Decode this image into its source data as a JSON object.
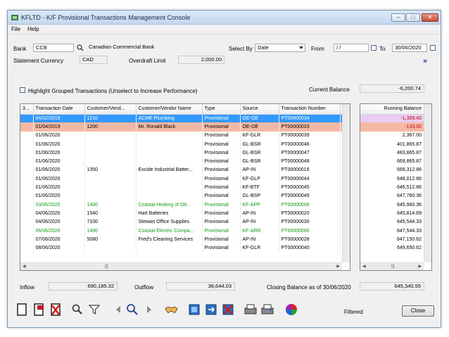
{
  "window": {
    "title": "KFLTD - K/F Provisional Transactions Management Console"
  },
  "menu": [
    "File",
    "Help"
  ],
  "bank": {
    "label": "Bank",
    "code": "CCB",
    "name": "Canadian Commercial Bank"
  },
  "select_by": {
    "label": "Select By",
    "value": "Date"
  },
  "from": {
    "label": "From",
    "value": "/ /"
  },
  "to": {
    "label": "To",
    "value": "30/06/2020"
  },
  "statement_currency": {
    "label": "Statement Currency",
    "value": "CAD"
  },
  "overdraft": {
    "label": "Overdraft Limit",
    "value": "2,000.00"
  },
  "highlight": {
    "label": "Highlight Grouped Transactions (Unselect to Increase Performance)"
  },
  "current_balance": {
    "label": "Current Balance",
    "value": "-6,200.74"
  },
  "grid": {
    "columns": [
      "3...",
      "Transaction Date",
      "Customer/Vend...",
      "Customer/Vendor Name",
      "Type",
      "Source",
      "Transaction Number",
      "D"
    ],
    "rows": [
      {
        "date": "04/02/2019",
        "code": "1210",
        "name": "ACME Plumbing",
        "type": "Provisional",
        "source": "OE-OE",
        "num": "PT00000034",
        "d": "",
        "style": "sel"
      },
      {
        "date": "01/04/2019",
        "code": "1200",
        "name": "Mr. Ronald Black",
        "type": "Provisional",
        "source": "OE-OE",
        "num": "PT00000033",
        "d": "",
        "style": "salmon"
      },
      {
        "date": "01/06/2020",
        "code": "",
        "name": "",
        "type": "Provisional",
        "source": "KF-GLR",
        "num": "PT00000039",
        "d": "E",
        "style": ""
      },
      {
        "date": "01/06/2020",
        "code": "",
        "name": "",
        "type": "Provisional",
        "source": "GL-BSR",
        "num": "PT00000046",
        "d": "A",
        "style": ""
      },
      {
        "date": "01/06/2020",
        "code": "",
        "name": "",
        "type": "Provisional",
        "source": "GL-BSR",
        "num": "PT00000047",
        "d": "A",
        "style": ""
      },
      {
        "date": "01/06/2020",
        "code": "",
        "name": "",
        "type": "Provisional",
        "source": "GL-BSR",
        "num": "PT00000048",
        "d": "A",
        "style": ""
      },
      {
        "date": "01/06/2020",
        "code": "1350",
        "name": "Excide Industrial Batter...",
        "type": "Provisional",
        "source": "AP-IN",
        "num": "PT00000016",
        "d": ".",
        "style": ""
      },
      {
        "date": "01/06/2020",
        "code": "",
        "name": "",
        "type": "Provisional",
        "source": "KF-GLP",
        "num": "PT00000044",
        "d": "L",
        "style": ""
      },
      {
        "date": "01/06/2020",
        "code": "",
        "name": "",
        "type": "Provisional",
        "source": "KF-BTF",
        "num": "PT00000045",
        "d": "",
        "style": ""
      },
      {
        "date": "01/06/2020",
        "code": "",
        "name": "",
        "type": "Provisional",
        "source": "GL-BSP",
        "num": "PT00000049",
        "d": "A",
        "style": ""
      },
      {
        "date": "03/06/2020",
        "code": "1400",
        "name": "Coastal Heating of Ott...",
        "type": "Provisional",
        "source": "KF-APP",
        "num": "PT00000008",
        "d": "(",
        "style": "green"
      },
      {
        "date": "04/06/2020",
        "code": "1540",
        "name": "Hart Batteries",
        "type": "Provisional",
        "source": "AP-IN",
        "num": "PT00000020",
        "d": ".",
        "style": ""
      },
      {
        "date": "04/06/2020",
        "code": "7100",
        "name": "Stewart Office Supplies",
        "type": "Provisional",
        "source": "AP-IN",
        "num": "PT00000030",
        "d": ".",
        "style": ""
      },
      {
        "date": "06/06/2020",
        "code": "1400",
        "name": "Coastal Electric Compa...",
        "type": "Provisional",
        "source": "KF-ARR",
        "num": "PT00000006",
        "d": "(",
        "style": "green"
      },
      {
        "date": "07/06/2020",
        "code": "5080",
        "name": "Fred's Cleaning Services",
        "type": "Provisional",
        "source": "AP-IN",
        "num": "PT00000028",
        "d": ".",
        "style": ""
      },
      {
        "date": "08/06/2020",
        "code": "",
        "name": "",
        "type": "Provisional",
        "source": "KF-GLR",
        "num": "PT00000040",
        "d": "E",
        "style": ""
      }
    ]
  },
  "running_balance": {
    "header": "Running Balance",
    "values": [
      {
        "v": "-1,359.40",
        "style": "pink"
      },
      {
        "v": "-133.00",
        "style": "salmon2"
      },
      {
        "v": "2,367.00",
        "style": ""
      },
      {
        "v": "401,865.87",
        "style": ""
      },
      {
        "v": "483,865.87",
        "style": ""
      },
      {
        "v": "669,865.87",
        "style": ""
      },
      {
        "v": "668,312.86",
        "style": ""
      },
      {
        "v": "648,012.86",
        "style": ""
      },
      {
        "v": "646,512.86",
        "style": ""
      },
      {
        "v": "647,760.36",
        "style": ""
      },
      {
        "v": "645,960.36",
        "style": ""
      },
      {
        "v": "645,814.69",
        "style": ""
      },
      {
        "v": "645,544.33",
        "style": ""
      },
      {
        "v": "647,544.33",
        "style": ""
      },
      {
        "v": "647,150.62",
        "style": ""
      },
      {
        "v": "649,650.62",
        "style": ""
      }
    ]
  },
  "totals": {
    "inflow_label": "Inflow",
    "inflow": "690,185.32",
    "outflow_label": "Outflow",
    "outflow": "38,644.03",
    "closing_label": "Closing Balance as of 30/06/2020",
    "closing": "645,340.55"
  },
  "status": {
    "filtered": "Filtered"
  },
  "buttons": {
    "close": "Close",
    "expand": "»"
  },
  "colors": {
    "selected": "#3399ff",
    "grouped": "#f4b9a4",
    "matched": "#159a15",
    "negative": "#c00000"
  }
}
